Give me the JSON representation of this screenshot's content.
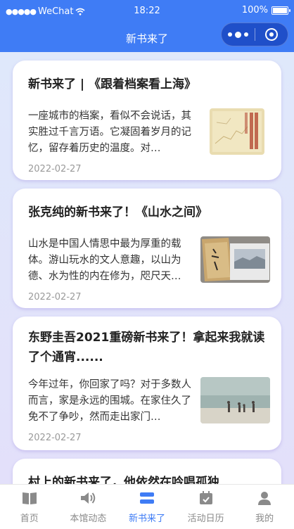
{
  "status_bar": {
    "carrier": "WeChat",
    "time": "18:22",
    "battery": "100%"
  },
  "nav": {
    "title": "新书来了"
  },
  "articles": [
    {
      "title": "新书来了 | 《跟着档案看上海》",
      "summary": "一座城市的档案，看似不会说话，其实胜过千言万语。它凝固着岁月的记忆，留存着历史的温度。对…",
      "date": "2022-02-27"
    },
    {
      "title": "张克纯的新书来了！《山水之间》",
      "summary": "山水是中国人情思中最为厚重的载体。游山玩水的文人意趣，以山为德、水为性的内在修为，咫尺天…",
      "date": "2022-02-27"
    },
    {
      "title": "东野圭吾2021重磅新书来了！拿起来我就读了个通宵......",
      "summary": "今年过年，你回家了吗？对于多数人而言，家是永远的围城。在家住久了免不了争吵，然而走出家门…",
      "date": "2022-02-27"
    },
    {
      "title": "村上的新书来了，他依然在吟唱孤独"
    }
  ],
  "tabs": [
    {
      "label": "首页",
      "icon": "book-icon"
    },
    {
      "label": "本馆动态",
      "icon": "speaker-icon"
    },
    {
      "label": "新书来了",
      "icon": "book-stack-icon",
      "active": true
    },
    {
      "label": "活动日历",
      "icon": "calendar-icon"
    },
    {
      "label": "我的",
      "icon": "user-icon"
    }
  ],
  "colors": {
    "primary": "#3f7cf5",
    "capsule": "#1f4fc9",
    "inactive": "#8a8a8a"
  }
}
